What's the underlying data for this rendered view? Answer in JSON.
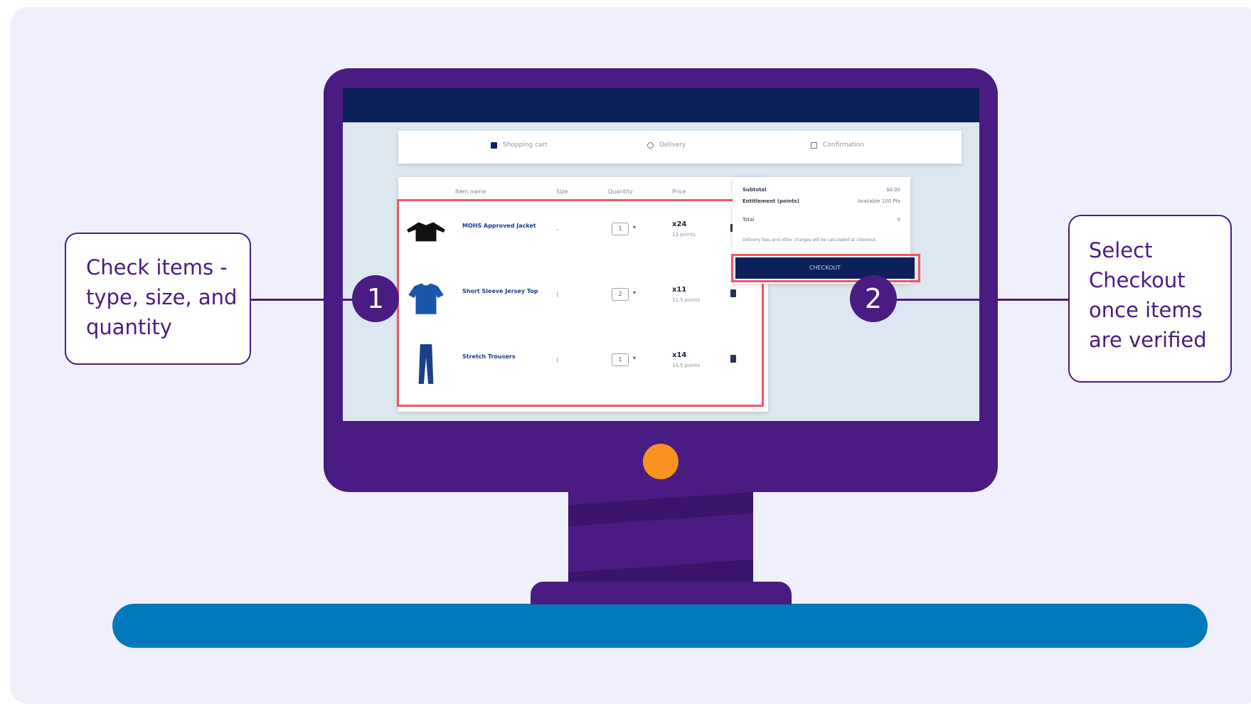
{
  "callouts": {
    "one": {
      "text": "Check items -\ntype, size, and\nquantity",
      "badge": "1"
    },
    "two": {
      "text": "Select\nCheckout\nonce items\nare verified",
      "badge": "2"
    }
  },
  "screen": {
    "steps": [
      "Shopping cart",
      "Delivery",
      "Confirmation"
    ],
    "table_headers": [
      "Item name",
      "Size",
      "Quantity",
      "Price"
    ],
    "items": [
      {
        "name": "MOHS Approved Jacket",
        "size": "-",
        "qty": "1",
        "price": "x24",
        "price_sub": "13 points",
        "icon": "jacket-icon"
      },
      {
        "name": "Short Sleeve Jersey Top",
        "size": "(",
        "qty": "2",
        "price": "x11",
        "price_sub": "11.5 points",
        "icon": "tshirt-icon"
      },
      {
        "name": "Stretch Trousers",
        "size": "(",
        "qty": "1",
        "price": "x14",
        "price_sub": "14.5 points",
        "icon": "trousers-icon"
      }
    ],
    "summary": {
      "subtotal_label": "Subtotal",
      "subtotal_value": "$0.00",
      "entitlement_label": "Entitlement (points)",
      "entitlement_value": "Available 100 Pts",
      "total_label": "Total",
      "total_value": "0",
      "note": "Delivery fees and other charges will be calculated at checkout",
      "checkout_label": "CHECKOUT"
    }
  },
  "colors": {
    "purple": "#4a1b82",
    "orange": "#f7931e",
    "blue": "#0179bb",
    "navy": "#0c2159",
    "highlight": "#f25566"
  }
}
